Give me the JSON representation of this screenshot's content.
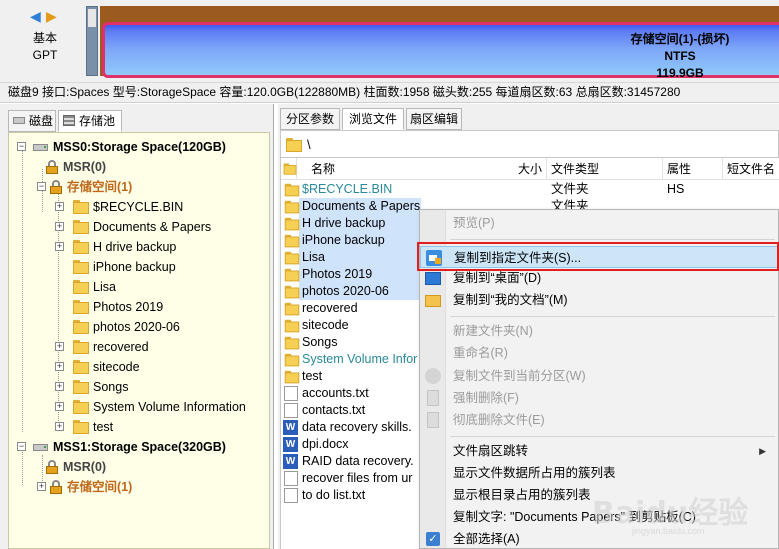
{
  "disk_band": {
    "nav_left": "◀",
    "nav_right": "▶",
    "disk_type": "基本",
    "disk_scheme": "GPT",
    "partition_name": "存储空间(1)-(损坏)",
    "partition_fs": "NTFS",
    "partition_size": "119.9GB"
  },
  "disk_info": "磁盘9 接口:Spaces  型号:StorageSpace  容量:120.0GB(122880MB)  柱面数:1958  磁头数:255  每道扇区数:63  总扇区数:31457280",
  "left_tabs": [
    {
      "label": "磁盘"
    },
    {
      "label": "存储池"
    }
  ],
  "tree": {
    "pool0": "MSS0:Storage Space(120GB)",
    "msr0": "MSR(0)",
    "storage0": "存储空间(1)",
    "folders": [
      "$RECYCLE.BIN",
      "Documents & Papers",
      "H drive backup",
      "iPhone backup",
      "Lisa",
      "Photos 2019",
      "photos 2020-06",
      "recovered",
      "sitecode",
      "Songs",
      "System Volume Information",
      "test"
    ],
    "pool1": "MSS1:Storage Space(320GB)",
    "msr1": "MSR(0)",
    "storage1": "存储空间(1)"
  },
  "right_tabs": [
    {
      "label": "分区参数"
    },
    {
      "label": "浏览文件"
    },
    {
      "label": "扇区编辑"
    }
  ],
  "path": "\\",
  "columns": {
    "name": "名称",
    "size": "大小",
    "type": "文件类型",
    "attr": "属性",
    "short": "短文件名"
  },
  "files": [
    {
      "name": "$RECYCLE.BIN",
      "type": "文件夹",
      "attr": "HS",
      "kind": "folder"
    },
    {
      "name": "Documents & Papers",
      "type": "文件夹",
      "attr": "",
      "kind": "folder"
    },
    {
      "name": "H drive backup",
      "type": "",
      "attr": "",
      "kind": "folder"
    },
    {
      "name": "iPhone backup",
      "type": "",
      "attr": "",
      "kind": "folder"
    },
    {
      "name": "Lisa",
      "type": "",
      "attr": "",
      "kind": "folder"
    },
    {
      "name": "Photos 2019",
      "type": "",
      "attr": "",
      "kind": "folder"
    },
    {
      "name": "photos 2020-06",
      "type": "",
      "attr": "",
      "kind": "folder"
    },
    {
      "name": "recovered",
      "type": "",
      "attr": "",
      "kind": "folder"
    },
    {
      "name": "sitecode",
      "type": "",
      "attr": "",
      "kind": "folder"
    },
    {
      "name": "Songs",
      "type": "",
      "attr": "",
      "kind": "folder"
    },
    {
      "name": "System Volume Infor",
      "type": "",
      "attr": "",
      "kind": "folder"
    },
    {
      "name": "test",
      "type": "",
      "attr": "",
      "kind": "folder"
    },
    {
      "name": "accounts.txt",
      "type": "",
      "attr": "",
      "kind": "txt"
    },
    {
      "name": "contacts.txt",
      "type": "",
      "attr": "",
      "kind": "txt"
    },
    {
      "name": "data recovery skills.",
      "type": "",
      "attr": "",
      "kind": "word"
    },
    {
      "name": "dpi.docx",
      "type": "",
      "attr": "",
      "kind": "word"
    },
    {
      "name": "RAID data recovery.",
      "type": "",
      "attr": "",
      "kind": "word"
    },
    {
      "name": "recover files from ur",
      "type": "",
      "attr": "",
      "kind": "txt"
    },
    {
      "name": "to do list.txt",
      "type": "",
      "attr": "",
      "kind": "txt"
    }
  ],
  "context_menu": {
    "preview": "预览(P)",
    "copy_to_folder": "复制到指定文件夹(S)...",
    "copy_to_desktop": "复制到“桌面”(D)",
    "copy_to_mydocs": "复制到“我的文档”(M)",
    "new_folder": "新建文件夹(N)",
    "rename": "重命名(R)",
    "copy_to_current": "复制文件到当前分区(W)",
    "force_delete": "强制删除(F)",
    "wipe_delete": "彻底删除文件(E)",
    "sector_jump": "文件扇区跳转",
    "show_clusters": "显示文件数据所占用的簇列表",
    "show_root_clusters": "显示根目录占用的簇列表",
    "copy_text": "复制文字: \"Documents  Papers\" 到剪贴板(C)",
    "select_all": "全部选择(A)"
  },
  "watermark": {
    "text": "Baidu经验",
    "sub": "jingyan.baidu.com"
  },
  "colors": {
    "accent": "#2f7fd6",
    "partition_border": "#e0306a",
    "highlight_box": "#e02020",
    "storage_orange": "#c0681a"
  }
}
